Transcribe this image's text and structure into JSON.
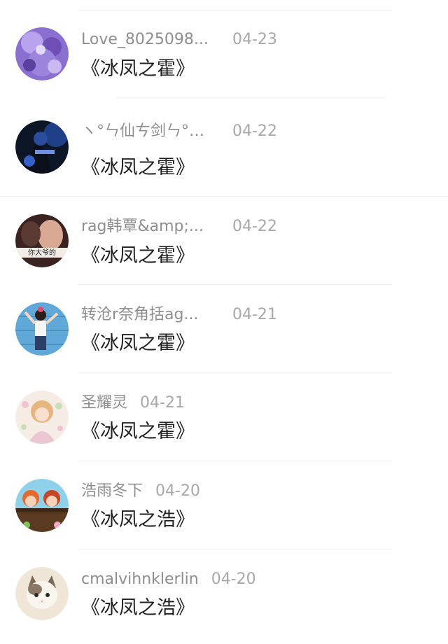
{
  "messages": [
    {
      "name": "Love_8025098...",
      "date": "04-23",
      "text": "《冰凤之霍》",
      "avatar": "purple-anime-avatar"
    },
    {
      "name": "ヽ°ㄣ仙ㄘ剑ㄣ°ゞ&...",
      "date": "04-22",
      "text": "《冰凤之霍》",
      "avatar": "dark-blue-anime-avatar"
    },
    {
      "name": "rag韩覃&amp;...",
      "date": "04-22",
      "text": "《冰凤之霍》",
      "avatar": "hand-photo-avatar"
    },
    {
      "name": "转沧r奈角括ag...",
      "date": "04-21",
      "text": "《冰凤之霍》",
      "avatar": "girl-blue-wall-avatar"
    },
    {
      "name": "圣耀灵",
      "date": "04-21",
      "text": "《冰凤之霍》",
      "avatar": "pastel-girl-avatar"
    },
    {
      "name": "浩雨冬下",
      "date": "04-20",
      "text": "《冰凤之浩》",
      "avatar": "cartoon-kids-avatar"
    },
    {
      "name": "cmalvihnklerlin",
      "date": "04-20",
      "text": "《冰凤之浩》",
      "avatar": "kitten-avatar"
    }
  ],
  "avatar_overlay_text": "你大爷的",
  "colors": {
    "name": "#8e8e8e",
    "date": "#a8a8a8",
    "text": "#222222",
    "divider": "#efefef"
  }
}
